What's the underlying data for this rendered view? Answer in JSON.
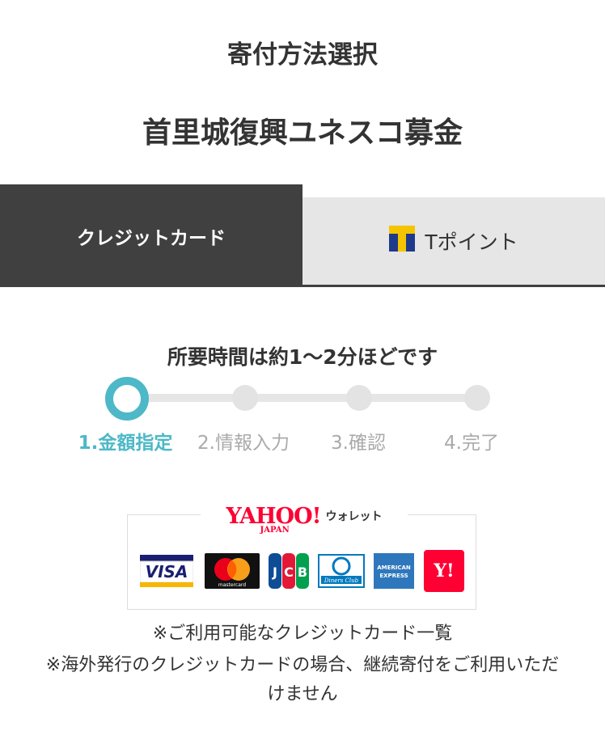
{
  "page": {
    "heading": "寄付方法選択",
    "campaign_title": "首里城復興ユネスコ募金"
  },
  "tabs": [
    {
      "label": "クレジットカード",
      "active": true
    },
    {
      "label": "Tポイント",
      "active": false,
      "icon": "tpoint-icon"
    }
  ],
  "progress": {
    "note": "所要時間は約1〜2分ほどです",
    "current_step": 1,
    "steps": [
      {
        "label": "1.金額指定"
      },
      {
        "label": "2.情報入力"
      },
      {
        "label": "3.確認"
      },
      {
        "label": "4.完了"
      }
    ]
  },
  "payment": {
    "wallet_logo": {
      "brand": "YAHOO!",
      "sub": "JAPAN",
      "label": "ウォレット"
    },
    "cards": [
      {
        "name": "VISA",
        "icon": "visa-icon"
      },
      {
        "name": "mastercard",
        "icon": "mastercard-icon"
      },
      {
        "name": "JCB",
        "icon": "jcb-icon"
      },
      {
        "name": "Diners Club",
        "icon": "diners-club-icon"
      },
      {
        "name": "AMERICAN EXPRESS",
        "icon": "amex-icon"
      },
      {
        "name": "Y!",
        "icon": "yahoo-card-icon"
      }
    ],
    "notes": [
      "※ご利用可能なクレジットカード一覧",
      "※海外発行のクレジットカードの場合、継続寄付をご利用いただ",
      "けません"
    ]
  },
  "colors": {
    "accent": "#4db8c7",
    "tab_active_bg": "#404040",
    "tab_inactive_bg": "#e6e6e6",
    "yahoo_red": "#ff0033"
  }
}
